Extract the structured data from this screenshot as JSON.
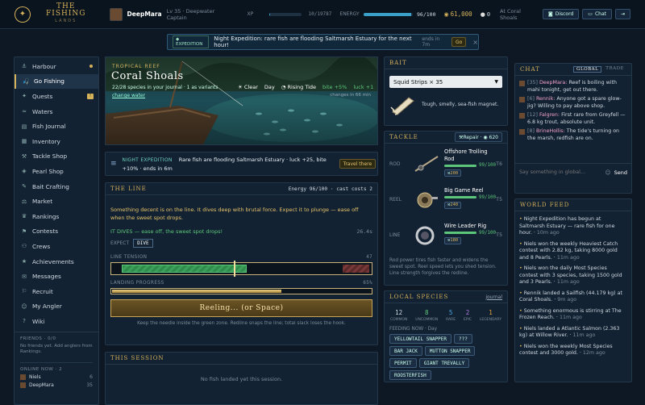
{
  "brand": {
    "title": "THE FISHING",
    "subtitle": "LANDS"
  },
  "player": {
    "name": "DeepMara",
    "level": "Lv 35 · Deepwater Captain",
    "xp_label": "XP",
    "xp_text": "10/19787",
    "xp_fraction": 0.0005,
    "energy_label": "ENERGY",
    "energy_text": "96/100",
    "energy_fraction": 0.96,
    "gold": "61,000",
    "pearls": "0",
    "location": "At Coral Shoals"
  },
  "topbuttons": {
    "discord": "Discord",
    "chat": "Chat",
    "logout": "⇥"
  },
  "banner": {
    "label": "EXPEDITION",
    "text": "Night Expedition: rare fish are flooding Saltmarsh Estuary for the next hour!",
    "ends": "ends in 7m",
    "go": "Go",
    "close": "×"
  },
  "nav": [
    {
      "icon": "⚓",
      "label": "Harbour",
      "dot": true
    },
    {
      "icon": "🎣",
      "label": "Go Fishing",
      "active": true
    },
    {
      "icon": "✦",
      "label": "Quests",
      "badge": "!"
    },
    {
      "icon": "≈",
      "label": "Waters"
    },
    {
      "icon": "▤",
      "label": "Fish Journal"
    },
    {
      "icon": "▦",
      "label": "Inventory"
    },
    {
      "icon": "⚒",
      "label": "Tackle Shop"
    },
    {
      "icon": "◈",
      "label": "Pearl Shop"
    },
    {
      "icon": "✎",
      "label": "Bait Crafting"
    },
    {
      "icon": "⚖",
      "label": "Market"
    },
    {
      "icon": "♛",
      "label": "Rankings"
    },
    {
      "icon": "⚑",
      "label": "Contests"
    },
    {
      "icon": "⚇",
      "label": "Crews"
    },
    {
      "icon": "★",
      "label": "Achievements"
    },
    {
      "icon": "✉",
      "label": "Messages"
    },
    {
      "icon": "⚐",
      "label": "Recruit"
    },
    {
      "icon": "☺",
      "label": "My Angler"
    },
    {
      "icon": "?",
      "label": "Wiki"
    }
  ],
  "friends": {
    "title": "FRIENDS · 0/0",
    "empty": "No friends yet. Add anglers from Rankings.",
    "online_title": "ONLINE NOW · 2",
    "online": [
      {
        "name": "Niels",
        "level": "6"
      },
      {
        "name": "DeepMara",
        "level": "35"
      }
    ]
  },
  "scene": {
    "region": "TROPICAL REEF",
    "name": "Coral Shoals",
    "species": "22/28 species in your journal · 1 as variants",
    "change": "change water",
    "weather": "Clear",
    "time": "Day",
    "tide": "Rising Tide",
    "tide_bonus_bite": "bite +5%",
    "tide_bonus_luck": "luck +1",
    "tide_changes": "changes in 66 min"
  },
  "night": {
    "label": "NIGHT EXPEDITION",
    "text": "Rare fish are flooding Saltmarsh Estuary · luck +25, bite +10% · ends in 6m",
    "button": "Travel there"
  },
  "line": {
    "title": "THE LINE",
    "energy": "Energy 96/100 · cast costs 2",
    "story": "Something decent is on the line. It dives deep with brutal force. Expect it to plunge — ease off when the sweet spot drops.",
    "status": "IT DIVES — ease off, the sweet spot drops!",
    "timer": "26.4s",
    "expect_label": "EXPECT",
    "expect": "DIVE",
    "tension_label": "LINE TENSION",
    "tension_value": "47",
    "tension_fraction": 0.47,
    "progress_label": "LANDING PROGRESS",
    "progress_value": "65%",
    "progress_fraction": 0.65,
    "reel_button": "Reeling... (or Space)",
    "hint": "Keep the needle inside the green zone. Redline snaps the line; total slack loses the hook."
  },
  "session": {
    "title": "THIS SESSION",
    "empty": "No fish landed yet this session."
  },
  "bait": {
    "title": "BAIT",
    "selected": "Squid Strips × 35",
    "desc": "Tough, smelly, sea-fish magnet."
  },
  "tackle": {
    "title": "TACKLE",
    "repair": "Repair · ◉ 620",
    "items": [
      {
        "slot": "ROD",
        "name": "Offshore Trolling Rod",
        "tier": "T6",
        "dur_text": "99/100",
        "dur_fraction": 0.99,
        "cost": "200"
      },
      {
        "slot": "REEL",
        "name": "Big Game Reel",
        "tier": "T5",
        "dur_text": "99/100",
        "dur_fraction": 0.99,
        "cost": "240"
      },
      {
        "slot": "LINE",
        "name": "Wire Leader Rig",
        "tier": "T5",
        "dur_text": "99/100",
        "dur_fraction": 0.99,
        "cost": "180"
      }
    ],
    "note": "Rod power tires fish faster and widens the sweet spot. Reel speed lets you shed tension. Line strength forgives the redline."
  },
  "species": {
    "title": "LOCAL SPECIES",
    "journal": "journal",
    "counts": [
      {
        "n": "12",
        "label": "COMMON",
        "color": "#cfd8e0"
      },
      {
        "n": "8",
        "label": "UNCOMMON",
        "color": "#5cc77a"
      },
      {
        "n": "5",
        "label": "RARE",
        "color": "#4aa3e0"
      },
      {
        "n": "2",
        "label": "EPIC",
        "color": "#b07ae0"
      },
      {
        "n": "1",
        "label": "LEGENDARY",
        "color": "#e0a83a"
      }
    ],
    "feeding_label": "FEEDING NOW · Day",
    "feeding": [
      "YELLOWTAIL SNAPPER",
      "???",
      "BAR JACK",
      "MUTTON SNAPPER",
      "PERMIT",
      "GIANT TREVALLY",
      "ROOSTERFISH"
    ]
  },
  "chat": {
    "title": "CHAT",
    "tab_global": "GLOBAL",
    "tab_trade": "TRADE",
    "messages": [
      {
        "lvl": "[35]",
        "name": "DeepMara:",
        "text": "Reef is boiling with mahi tonight, get out there."
      },
      {
        "lvl": "[6]",
        "name": "Rennik:",
        "text": "Anyone got a spare glow-jig? Willing to pay above shop."
      },
      {
        "lvl": "[12]",
        "name": "Falgren:",
        "text": "First rare from Greyfell — 6.8 kg trout, absolute unit."
      },
      {
        "lvl": "[8]",
        "name": "BrineHollis:",
        "text": "The tide's turning on the marsh, redfish are on."
      }
    ],
    "placeholder": "Say something in global...",
    "send": "Send"
  },
  "world": {
    "title": "WORLD FEED",
    "items": [
      {
        "text": "Night Expedition has begun at Saltmarsh Estuary — rare fish for one hour.",
        "time": "10m ago"
      },
      {
        "text": "Niels won the weekly Heaviest Catch contest with 2.82 kg, taking 8000 gold and 8 Pearls.",
        "time": "11m ago"
      },
      {
        "text": "Niels won the daily Most Species contest with 3 species, taking 1500 gold and 3 Pearls.",
        "time": "11m ago"
      },
      {
        "text": "Rennik landed a Sailfish (44.179 kg) at Coral Shoals.",
        "time": "9m ago"
      },
      {
        "text": "Something enormous is stirring at The Frozen Reach.",
        "time": "11m ago"
      },
      {
        "text": "Niels landed a Atlantic Salmon (2.363 kg) at Willow River.",
        "time": "11m ago"
      },
      {
        "text": "Niels won the weekly Most Species contest and 3000 gold.",
        "time": "12m ago"
      }
    ]
  },
  "colors": {
    "accent": "#d6b25a",
    "panel": "#132232",
    "green": "#5cc77a",
    "blue": "#3aa0c8"
  }
}
